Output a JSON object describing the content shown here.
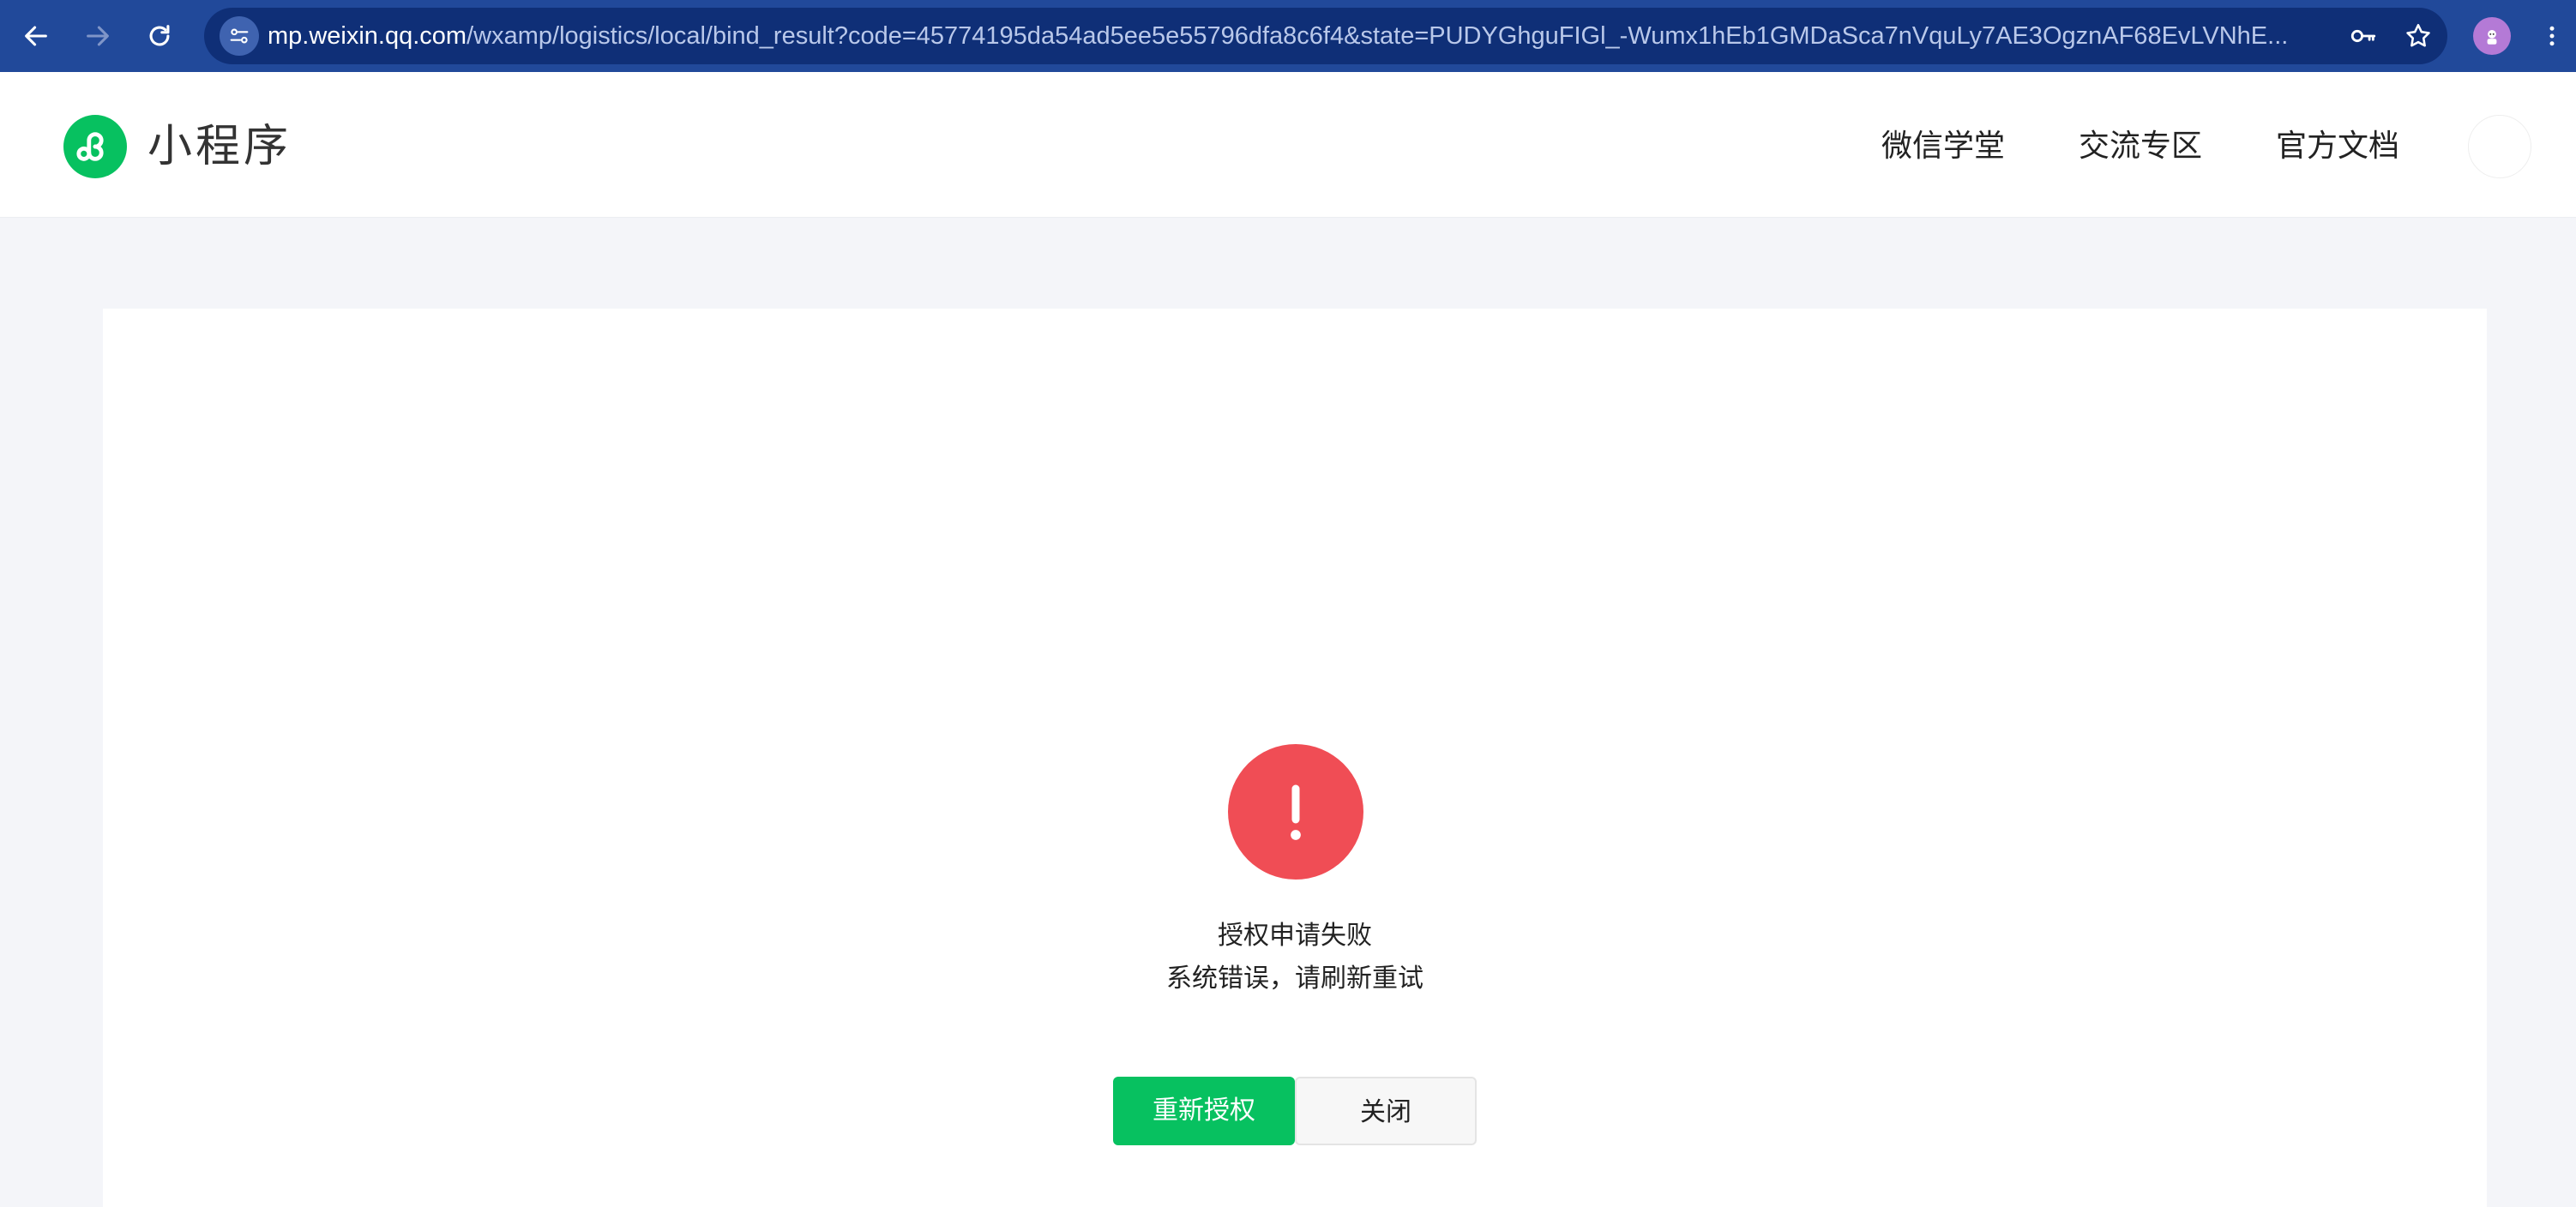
{
  "browser": {
    "url_host": "mp.weixin.qq.com",
    "url_path": "/wxamp/logistics/local/bind_result?code=45774195da54ad5ee5e55796dfa8c6f4&state=PUDYGhguFIGl_-Wumx1hEb1GMDaSca7nVquLy7AE3OgznAF68EvLVNhE...",
    "icons": [
      "back-icon",
      "forward-icon",
      "reload-icon",
      "site-settings-icon",
      "key-icon",
      "star-icon",
      "profile-avatar",
      "menu-dots-icon"
    ]
  },
  "header": {
    "brand": "小程序",
    "nav": [
      "微信学堂",
      "交流专区",
      "官方文档"
    ]
  },
  "result": {
    "title": "授权申请失败",
    "description": "系统错误，请刷新重试",
    "primary_button": "重新授权",
    "secondary_button": "关闭"
  },
  "colors": {
    "chrome": "#21499a",
    "brand_green": "#07c160",
    "error_red": "#f04d55"
  }
}
